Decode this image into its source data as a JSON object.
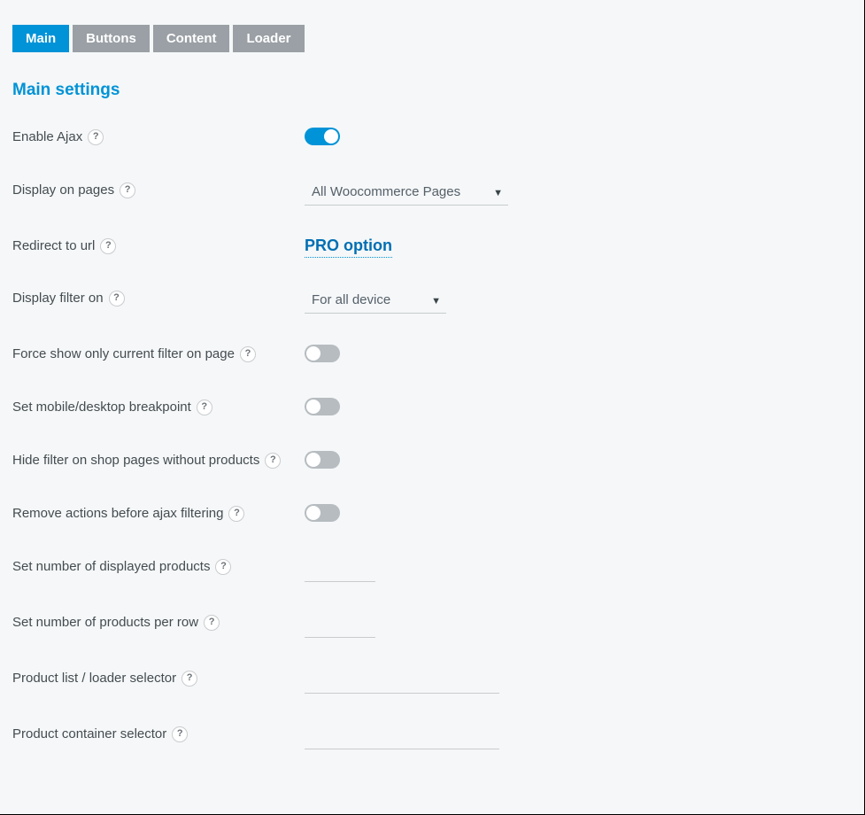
{
  "tabs": {
    "main": "Main",
    "buttons": "Buttons",
    "content": "Content",
    "loader": "Loader"
  },
  "section_title": "Main settings",
  "help_glyph": "?",
  "caret_glyph": "▼",
  "rows": {
    "enable_ajax": {
      "label": "Enable Ajax",
      "value": true
    },
    "display_on_pages": {
      "label": "Display on pages",
      "selected": "All Woocommerce Pages"
    },
    "redirect_to_url": {
      "label": "Redirect to url",
      "pro_text": "PRO option"
    },
    "display_filter_on": {
      "label": "Display filter on",
      "selected": "For all device"
    },
    "force_show": {
      "label": "Force show only current filter on page",
      "value": false
    },
    "breakpoint": {
      "label": "Set mobile/desktop breakpoint",
      "value": false
    },
    "hide_empty": {
      "label": "Hide filter on shop pages without products",
      "value": false
    },
    "remove_actions": {
      "label": "Remove actions before ajax filtering",
      "value": false
    },
    "num_displayed": {
      "label": "Set number of displayed products",
      "value": ""
    },
    "num_per_row": {
      "label": "Set number of products per row",
      "value": ""
    },
    "list_selector": {
      "label": "Product list / loader selector",
      "value": ""
    },
    "container_selector": {
      "label": "Product container selector",
      "value": ""
    }
  }
}
